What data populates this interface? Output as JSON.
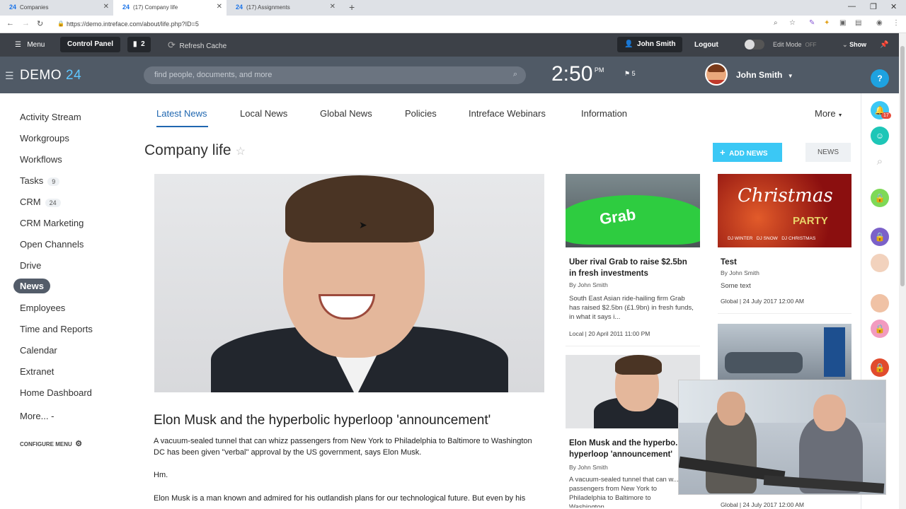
{
  "browser": {
    "tabs": [
      {
        "favicon": "24",
        "title": "Companies"
      },
      {
        "favicon": "24",
        "title": "(17) Company life"
      },
      {
        "favicon": "24",
        "title": "(17) Assignments"
      }
    ],
    "url": "https://demo.intreface.com/about/life.php?ID=5"
  },
  "adminbar": {
    "menu": "Menu",
    "control_panel": "Control Panel",
    "notif_count": "2",
    "refresh": "Refresh Cache",
    "user": "John Smith",
    "logout": "Logout",
    "edit_mode": "Edit Mode",
    "edit_state": "OFF",
    "show": "Show"
  },
  "header": {
    "logo_text": "DEMO",
    "logo_num": "24",
    "search_placeholder": "find people, documents, and more",
    "time": "2:50",
    "ampm": "PM",
    "flag_count": "5",
    "username": "John Smith"
  },
  "sidebar": {
    "items": [
      {
        "label": "Activity Stream",
        "count": ""
      },
      {
        "label": "Workgroups",
        "count": ""
      },
      {
        "label": "Workflows",
        "count": ""
      },
      {
        "label": "Tasks",
        "count": "9"
      },
      {
        "label": "CRM",
        "count": "24"
      },
      {
        "label": "CRM Marketing",
        "count": ""
      },
      {
        "label": "Open Channels",
        "count": ""
      },
      {
        "label": "Drive",
        "count": ""
      },
      {
        "label": "News",
        "count": ""
      },
      {
        "label": "Employees",
        "count": ""
      },
      {
        "label": "Time and Reports",
        "count": ""
      },
      {
        "label": "Calendar",
        "count": ""
      },
      {
        "label": "Extranet",
        "count": ""
      },
      {
        "label": "Home Dashboard",
        "count": ""
      },
      {
        "label": "More... -",
        "count": ""
      }
    ],
    "configure": "CONFIGURE MENU"
  },
  "tabs": [
    "Latest News",
    "Local News",
    "Global News",
    "Policies",
    "Intreface Webinars",
    "Information",
    "More"
  ],
  "page": {
    "title": "Company life",
    "add_news": "ADD NEWS",
    "news": "NEWS"
  },
  "main_article": {
    "title": "Elon Musk and the hyperbolic hyperloop 'announcement'",
    "lead": "A vacuum-sealed tunnel that can whizz passengers from New York to Philadelphia to Baltimore to Washington DC has been given \"verbal\" approval by the US government, says Elon Musk.",
    "hm": "Hm.",
    "body": "Elon Musk is a man known and admired for his outlandish plans for our technological future. But even by his"
  },
  "cards": {
    "grab": {
      "title": "Uber rival Grab to raise $2.5bn in fresh investments",
      "author": "By John Smith",
      "text": "South East Asian ride-hailing firm Grab has raised $2.5bn (£1.9bn) in fresh funds, in what it says i...",
      "meta": "Local | 20 April 2011 11:00 PM",
      "img_label": "Grab"
    },
    "test": {
      "title": "Test",
      "author": "By John Smith",
      "text": "Some text",
      "meta": "Global | 24 July 2017 12:00 AM",
      "img_title": "Christmas",
      "img_sub": "PARTY",
      "img_names": "DJ WINTER   DJ SNOW   DJ CHRISTMAS"
    },
    "musk": {
      "title": "Elon Musk and the hyperbo... hyperloop 'announcement'",
      "author": "By John Smith",
      "text": "A vacuum-sealed tunnel that can w... passengers from New York to Philadelphia to Baltimore to Washington...",
      "meta": "Global | 24 July 2017 12:00 AM"
    }
  },
  "rpanel": {
    "badge": "17"
  },
  "colors": {
    "accent": "#3bc8f5",
    "header": "#505a66",
    "adminbar": "#3d4148",
    "active_tab": "#2067b0"
  }
}
